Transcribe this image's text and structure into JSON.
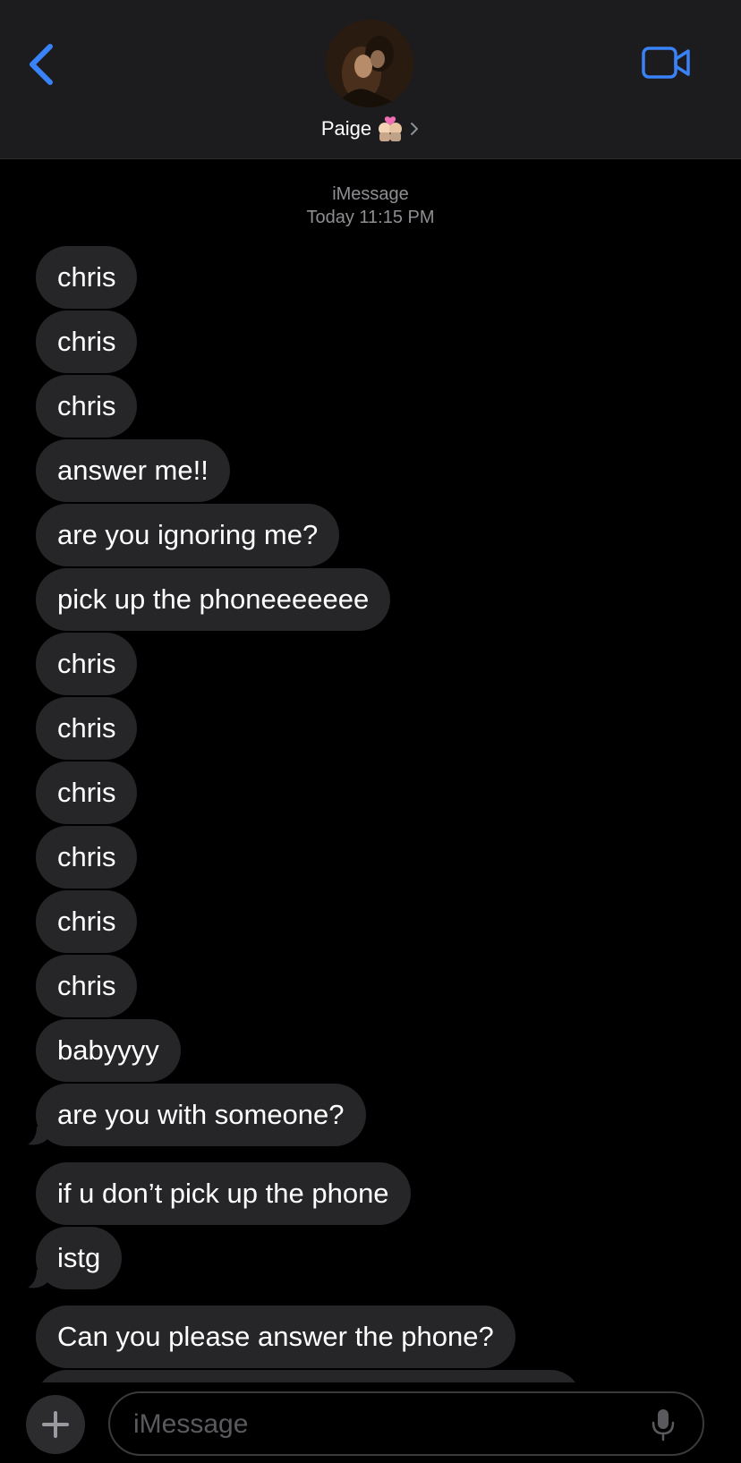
{
  "header": {
    "contact_name": "Paige",
    "back_icon": "chevron-left-icon",
    "video_icon": "video-camera-icon",
    "accent_color": "#3a82f7"
  },
  "thread": {
    "service": "iMessage",
    "timestamp": "Today 11:15 PM",
    "messages": [
      "chris",
      "chris",
      "chris",
      "answer me!!",
      "are you ignoring me?",
      "pick up the phoneeeeeee",
      "chris",
      "chris",
      "chris",
      "chris",
      "chris",
      "chris",
      "babyyyy",
      "are you with someone?",
      "if u don’t pick up the phone",
      "istg",
      "Can you please answer the phone?"
    ]
  },
  "input_bar": {
    "placeholder": "iMessage",
    "plus_icon": "plus-icon",
    "mic_icon": "microphone-icon"
  }
}
